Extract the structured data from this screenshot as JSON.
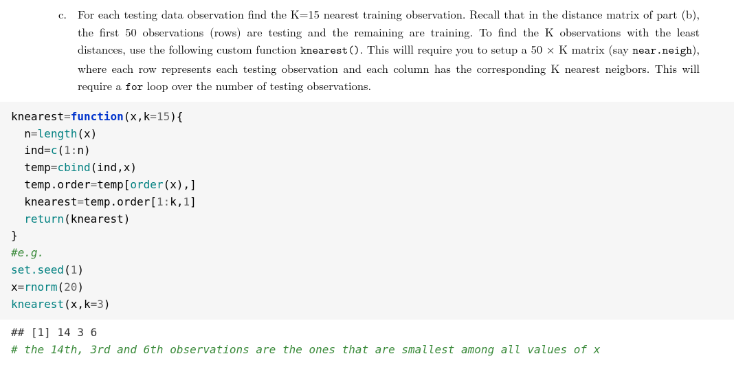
{
  "question": {
    "marker": "c.",
    "text_parts": {
      "p1": "For each testing data observation find the K=15 nearest training observation. Recall that in the distance matrix of part (b), the first 50 observations (rows) are testing and the remaining are training. To find the K observations with the least distances, use the following custom function ",
      "code1": "knearest()",
      "p2": ". This willl require you to setup a 50 × K matrix (say ",
      "code2": "near.neigh",
      "p3": "), where each row represents each testing observation and each column has the corresponding K nearest neigbors. This will require a ",
      "code3": "for",
      "p4": " loop over the number of testing observations."
    }
  },
  "code": {
    "l1": {
      "a": "knearest",
      "b": "=",
      "c": "function",
      "d": "(x,k",
      "e": "=",
      "f": "15",
      "g": "){"
    },
    "l2": {
      "a": "  n",
      "b": "=",
      "c": "length",
      "d": "(x)"
    },
    "l3": {
      "a": "  ind",
      "b": "=",
      "c": "c",
      "d": "(",
      "e": "1",
      "f": ":",
      "g": "n)"
    },
    "l4": {
      "a": "  temp",
      "b": "=",
      "c": "cbind",
      "d": "(ind,x)"
    },
    "l5": {
      "a": "  temp.order",
      "b": "=",
      "c": "temp[",
      "d": "order",
      "e": "(x),]"
    },
    "l6": {
      "a": "  knearest",
      "b": "=",
      "c": "temp.order[",
      "d": "1",
      "e": ":",
      "f": "k,",
      "g": "1",
      "h": "]"
    },
    "l7": {
      "a": "  ",
      "b": "return",
      "c": "(knearest)"
    },
    "l8": {
      "a": "}"
    },
    "l9": {
      "a": "#e.g."
    },
    "l10": {
      "a": "set.seed",
      "b": "(",
      "c": "1",
      "d": ")"
    },
    "l11": {
      "a": "x",
      "b": "=",
      "c": "rnorm",
      "d": "(",
      "e": "20",
      "f": ")"
    },
    "l12": {
      "a": "knearest",
      "b": "(x,k",
      "c": "=",
      "d": "3",
      "e": ")"
    }
  },
  "output": "## [1] 14  3  6",
  "final_comment": "# the 14th, 3rd and 6th observations are the ones that are smallest among all values of x"
}
